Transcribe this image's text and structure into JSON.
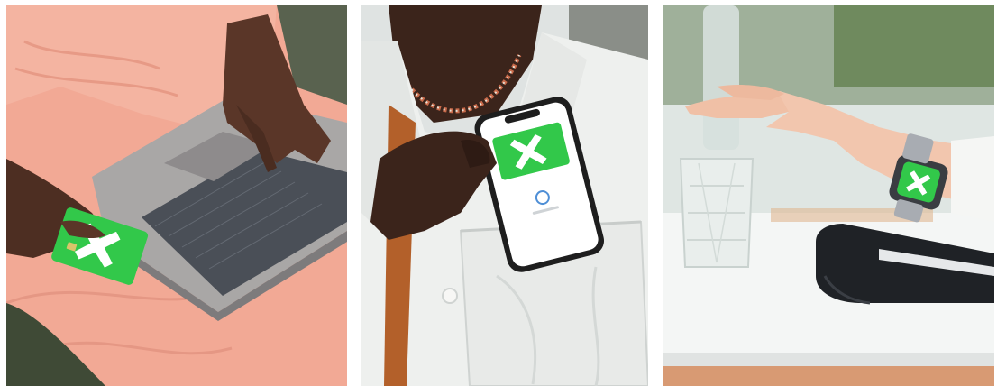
{
  "brand": {
    "accent_green": "#32c84a",
    "mark_white": "#ffffff"
  },
  "panels": [
    {
      "id": "laptop-card-photo",
      "icon": "x-logo-card"
    },
    {
      "id": "phone-pocket-photo",
      "icon": "x-logo-phone"
    },
    {
      "id": "smartwatch-payment-photo",
      "icon": "x-logo-watch"
    }
  ]
}
